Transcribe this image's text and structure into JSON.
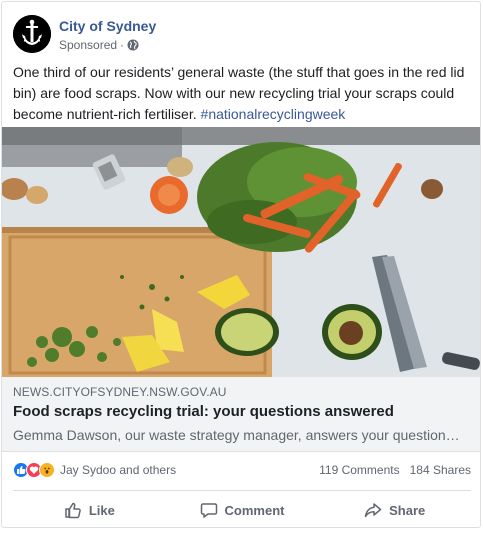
{
  "post": {
    "page_name": "City of Sydney",
    "sponsored_label": "Sponsored",
    "meta_separator": "·",
    "privacy_icon": "globe-icon",
    "caption_text": "One third of our residents’ general waste (the stuff that goes in the red lid bin) are food scraps. Now with our new recycling trial your scraps could become nutrient-rich fertiliser. ",
    "caption_hashtag": "#nationalrecyclingweek"
  },
  "link_preview": {
    "domain": "NEWS.CITYOFSYDNEY.NSW.GOV.AU",
    "title": "Food scraps recycling trial: your questions answered",
    "description": "Gemma Dawson, our waste strategy manager, answers your questions..."
  },
  "engagement": {
    "reaction_icons": [
      "like-icon",
      "love-icon",
      "wow-icon"
    ],
    "reactors": "Jay Sydoo and others",
    "comments": "119 Comments",
    "shares": "184 Shares"
  },
  "actions": {
    "like": "Like",
    "comment": "Comment",
    "share": "Share"
  },
  "colors": {
    "link_blue": "#385898",
    "muted_text": "#606770",
    "preview_bg": "#f2f3f5",
    "like_blue": "#1877f2",
    "love_red": "#f33e58",
    "wow_yellow": "#f7b125"
  }
}
